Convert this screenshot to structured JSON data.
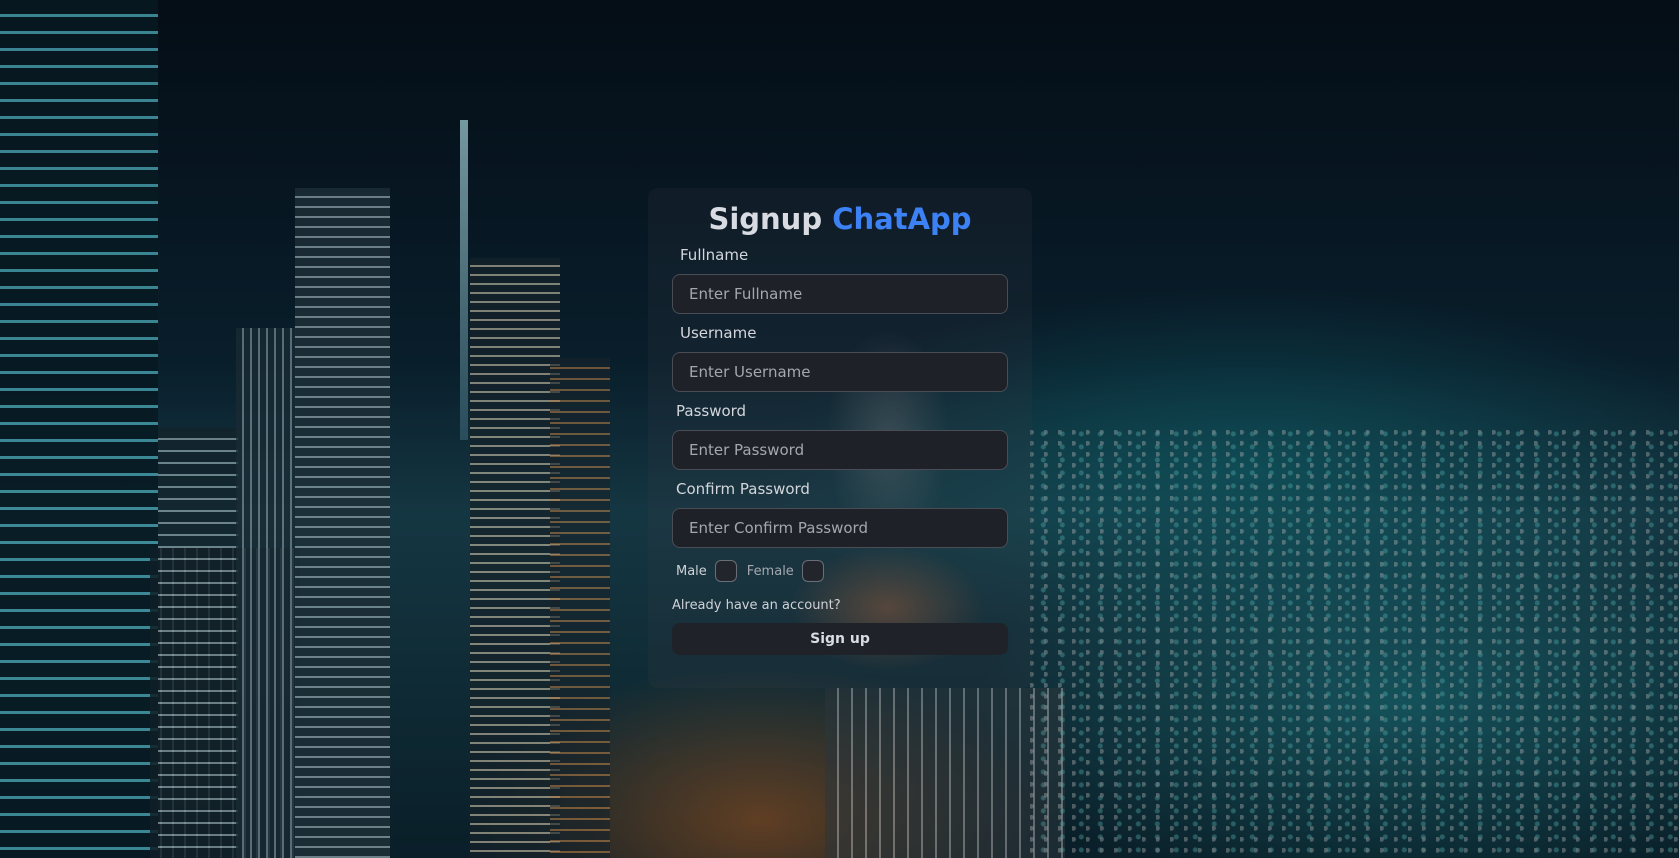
{
  "signup": {
    "title_prefix": "Signup",
    "title_brand": "ChatApp",
    "fullname": {
      "label": "Fullname",
      "placeholder": "Enter Fullname",
      "value": ""
    },
    "username": {
      "label": "Username",
      "placeholder": "Enter Username",
      "value": ""
    },
    "password": {
      "label": "Password",
      "placeholder": "Enter Password",
      "value": ""
    },
    "confirm_password": {
      "label": "Confirm Password",
      "placeholder": "Enter Confirm Password",
      "value": ""
    },
    "gender": {
      "male_label": "Male",
      "female_label": "Female",
      "male_checked": false,
      "female_checked": false
    },
    "login_link": "Already have an account?",
    "submit_label": "Sign up"
  },
  "colors": {
    "brand_accent": "#3d82f5",
    "input_background": "#1e2128",
    "button_background": "#1f2228"
  }
}
